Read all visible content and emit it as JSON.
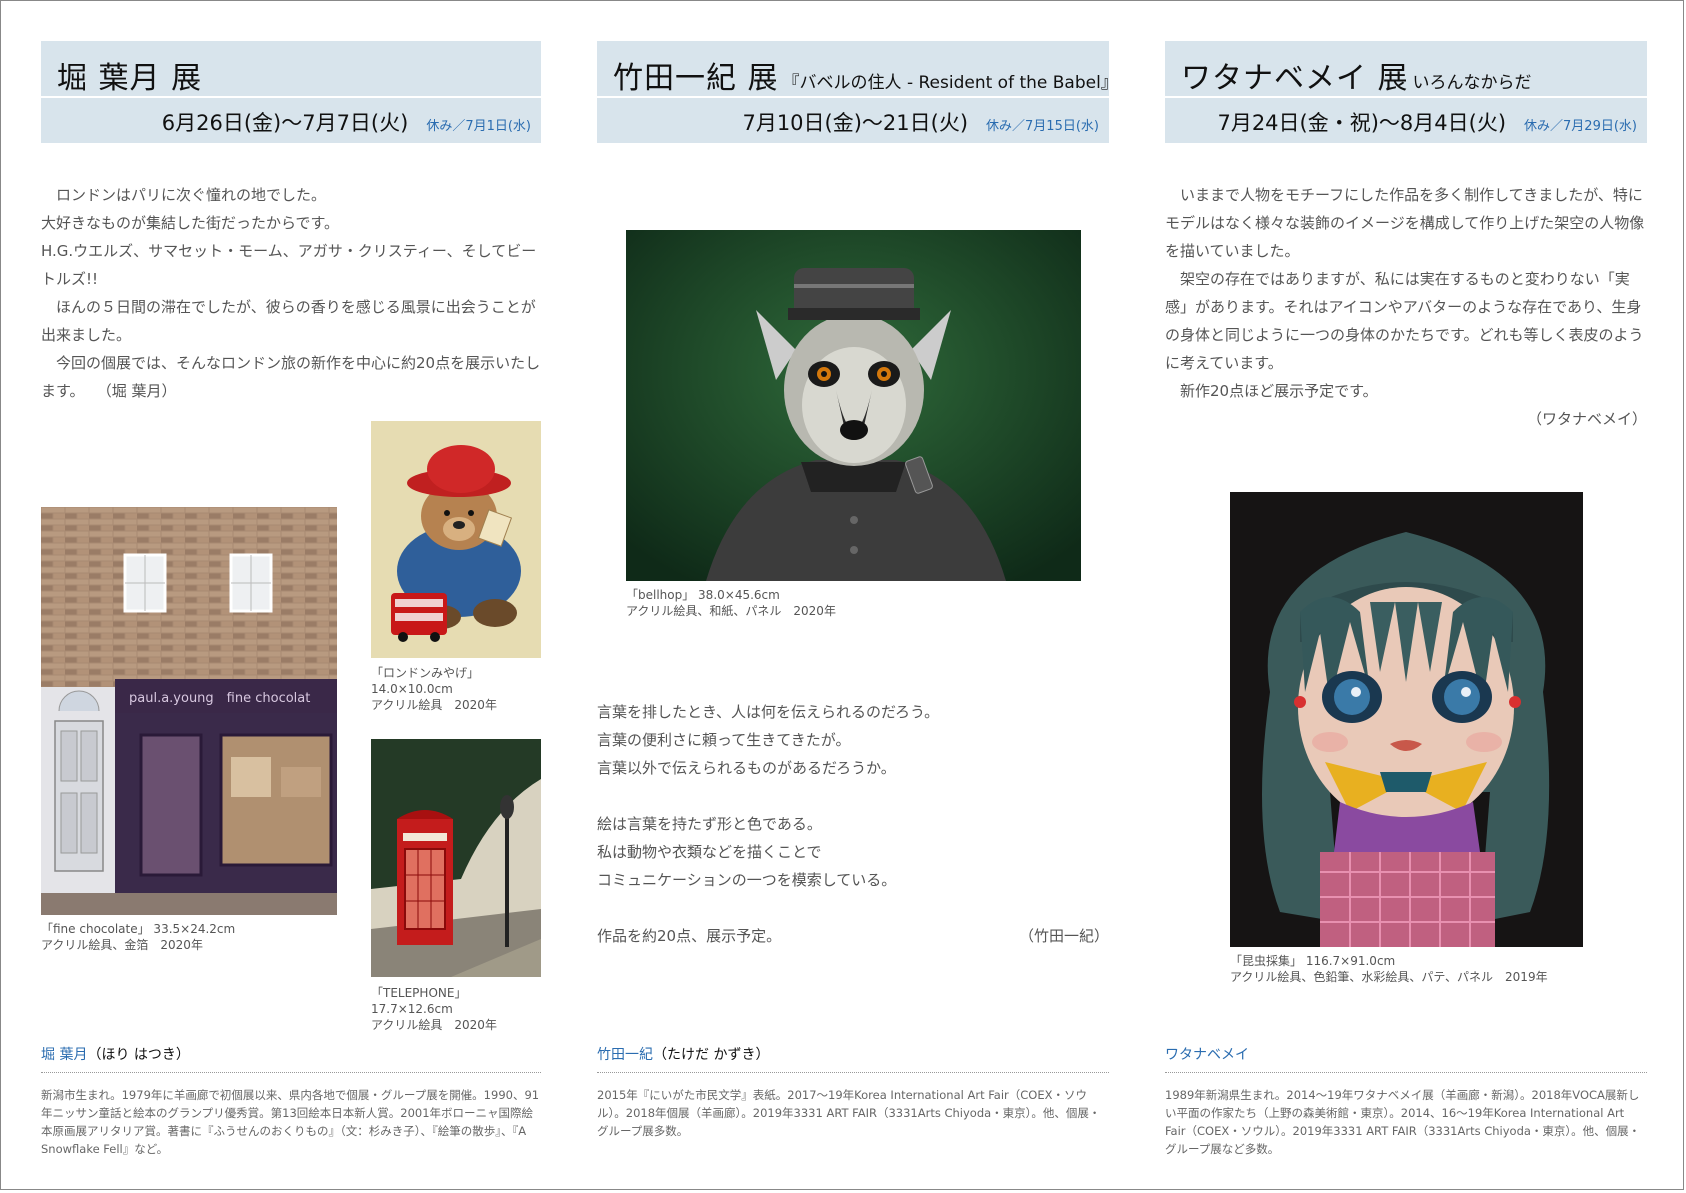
{
  "col1": {
    "title": "堀 葉月 展",
    "date": "6月26日(金)〜7月7日(火)",
    "off": "休み／7月1日(水)",
    "paragraphs": [
      "　ロンドンはパリに次ぐ憧れの地でした。",
      "大好きなものが集結した街だったからです。",
      "H.G.ウエルズ、サマセット・モーム、アガサ・クリスティー、そしてビートルズ!!",
      "　ほんの５日間の滞在でしたが、彼らの香りを感じる風景に出会うことが出来ました。",
      "　今回の個展では、そんなロンドン旅の新作を中心に約20点を展示いたします。　 （堀 葉月）"
    ],
    "art1_caption": [
      "「fine chocolate」 33.5×24.2cm",
      "アクリル絵具、金箔　2020年"
    ],
    "art2_caption": [
      "「ロンドンみやげ」",
      "14.0×10.0cm",
      "アクリル絵具　2020年"
    ],
    "art3_caption": [
      "「TELEPHONE」",
      "17.7×12.6cm",
      "アクリル絵具　2020年"
    ],
    "shop_sign": "paul.a.young　fine chocolat",
    "bio_name": "堀 葉月",
    "bio_reading": "（ほり はつき）",
    "bio": "新潟市生まれ。1979年に羊画廊で初個展以来、県内各地で個展・グループ展を開催。1990、91年ニッサン童話と絵本のグランプリ優秀賞。第13回絵本日本新人賞。2001年ボローニャ国際絵本原画展アリタリア賞。著書に『ふうせんのおくりもの』（文：杉みき子）、『絵筆の散歩』、『A Snowflake Fell』など。"
  },
  "col2": {
    "title": "竹田一紀 展",
    "subtitle": "『バベルの住人 - Resident of the Babel』",
    "date": "7月10日(金)〜21日(火)",
    "off": "休み／7月15日(水)",
    "art_caption": [
      "「bellhop」 38.0×45.6cm",
      "アクリル絵具、和紙、パネル　2020年"
    ],
    "lines": [
      "言葉を排したとき、人は何を伝えられるのだろう。",
      "言葉の便利さに頼って生きてきたが。",
      "言葉以外で伝えられるものがあるだろうか。",
      "",
      "絵は言葉を持たず形と色である。",
      "私は動物や衣類などを描くことで",
      "コミュニケーションの一つを模索している。",
      ""
    ],
    "last_line": "作品を約20点、展示予定。",
    "signature": "（竹田一紀）",
    "bio_name": "竹田一紀",
    "bio_reading": "（たけだ かずき）",
    "bio": "2015年『にいがた市民文学』表紙。2017〜19年Korea International Art Fair（COEX・ソウル）。2018年個展（羊画廊）。2019年3331 ART FAIR（3331Arts Chiyoda・東京）。他、個展・グループ展多数。"
  },
  "col3": {
    "title": "ワタナベメイ 展",
    "subtitle": "いろんなからだ",
    "date": "7月24日(金・祝)〜8月4日(火)",
    "off": "休み／7月29日(水)",
    "paragraphs": [
      "　いままで人物をモチーフにした作品を多く制作してきましたが、特にモデルはなく様々な装飾のイメージを構成して作り上げた架空の人物像を描いていました。",
      "　架空の存在ではありますが、私には実在するものと変わりない「実感」があります。それはアイコンやアバターのような存在であり、生身の身体と同じように一つの身体のかたちです。どれも等しく表皮のように考えています。",
      "　新作20点ほど展示予定です。"
    ],
    "signature": "（ワタナベメイ）",
    "art_caption": [
      "「昆虫採集」 116.7×91.0cm",
      "アクリル絵具、色鉛筆、水彩絵具、パテ、パネル　2019年"
    ],
    "bio_name": "ワタナベメイ",
    "bio": "1989年新潟県生まれ。2014〜19年ワタナベメイ展（羊画廊・新潟）。2018年VOCA展新しい平面の作家たち（上野の森美術館・東京）。2014、16〜19年Korea International Art Fair（COEX・ソウル）。2019年3331 ART FAIR（3331Arts Chiyoda・東京）。他、個展・グループ展など多数。"
  },
  "colors": {
    "header_bg": "#d8e4ec",
    "accent_blue": "#2a6cb0",
    "text": "#555555"
  },
  "icons": [
    "brick-shopfront-painting",
    "teddy-bear-painting",
    "phone-box-painting",
    "lemur-bellhop-painting",
    "girl-portrait-painting"
  ]
}
